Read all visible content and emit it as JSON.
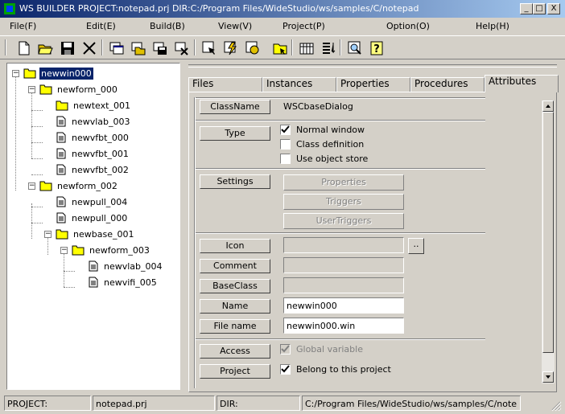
{
  "window": {
    "title": "WS BUILDER PROJECT:notepad.prj DIR:C:/Program Files/WideStudio/ws/samples/C/notepad",
    "minimize": "_",
    "maximize": "□",
    "close": "X"
  },
  "menu": [
    "File(F)",
    "Edit(E)",
    "Build(B)",
    "View(V)",
    "Project(P)",
    "Option(O)",
    "Help(H)"
  ],
  "toolbar": {
    "icons": [
      "new-file-icon",
      "open-folder-icon",
      "save-icon",
      "cut-icon",
      "new-window-icon",
      "open-window-icon",
      "save-window-icon",
      "close-window-icon",
      "select-icon",
      "build-icon",
      "compile-icon",
      "folder-open-icon",
      "grid-icon",
      "list-icon",
      "preview-icon",
      "help-icon"
    ]
  },
  "tree": {
    "nodes": [
      {
        "label": "newwin000",
        "selected": true
      },
      {
        "label": "newform_000"
      },
      {
        "label": "newtext_001"
      },
      {
        "label": "newvlab_003"
      },
      {
        "label": "newvfbt_000"
      },
      {
        "label": "newvfbt_001"
      },
      {
        "label": "newvfbt_002"
      },
      {
        "label": "newform_002"
      },
      {
        "label": "newpull_004"
      },
      {
        "label": "newpull_000"
      },
      {
        "label": "newbase_001"
      },
      {
        "label": "newform_003"
      },
      {
        "label": "newvlab_004"
      },
      {
        "label": "newvifi_005"
      }
    ],
    "collapse": "−"
  },
  "tabs": [
    "Files",
    "Instances",
    "Properties",
    "Procedures",
    "Attributes"
  ],
  "attributes": {
    "classname_label": "ClassName",
    "classname_value": "WSCbaseDialog",
    "type_label": "Type",
    "type_options": [
      {
        "label": "Normal window",
        "checked": true
      },
      {
        "label": "Class definition",
        "checked": false
      },
      {
        "label": "Use object store",
        "checked": false
      }
    ],
    "settings_label": "Settings",
    "settings_buttons": [
      "Properties",
      "Triggers",
      "UserTriggers"
    ],
    "icon_label": "Icon",
    "icon_value": "",
    "browse_label": "..",
    "comment_label": "Comment",
    "comment_value": "",
    "baseclass_label": "BaseClass",
    "baseclass_value": "",
    "name_label": "Name",
    "name_value": "newwin000",
    "filename_label": "File name",
    "filename_value": "newwin000.win",
    "access_label": "Access",
    "access_option": {
      "label": "Global variable",
      "checked": true
    },
    "project_label": "Project",
    "project_option": {
      "label": "Belong to this project",
      "checked": true
    }
  },
  "status": {
    "project_label": "PROJECT:",
    "project_value": "notepad.prj",
    "dir_label": "DIR:",
    "dir_value": "C:/Program Files/WideStudio/ws/samples/C/note"
  },
  "colors": {
    "face": "#d4d0c8",
    "title_start": "#0a246a",
    "title_end": "#a6caf0",
    "selection": "#0a246a",
    "folder": "#ffff00"
  }
}
